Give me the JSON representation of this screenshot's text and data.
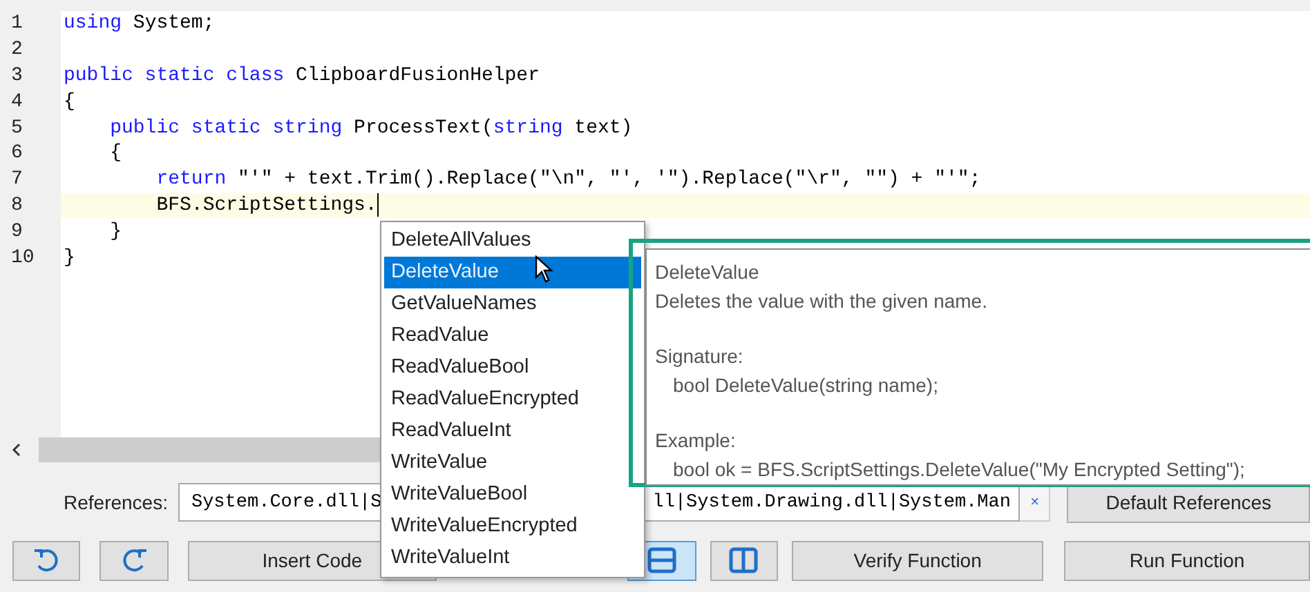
{
  "editor": {
    "lines": [
      {
        "number": "1",
        "current": false,
        "tokens": [
          {
            "kind": "keyword",
            "text": "using"
          },
          {
            "kind": "plain",
            "text": " System;"
          }
        ]
      },
      {
        "number": "2",
        "current": false
      },
      {
        "number": "3",
        "current": false,
        "tokens": [
          {
            "kind": "keyword",
            "text": "public static class"
          },
          {
            "kind": "plain",
            "text": " ClipboardFusionHelper"
          }
        ]
      },
      {
        "number": "4",
        "current": false,
        "tokens": [
          {
            "kind": "plain",
            "text": "{"
          }
        ]
      },
      {
        "number": "5",
        "current": false,
        "tokens": [
          {
            "kind": "keyword",
            "text": "    public static string"
          },
          {
            "kind": "plain",
            "text": " ProcessText("
          },
          {
            "kind": "keyword",
            "text": "string"
          },
          {
            "kind": "plain",
            "text": " text)"
          }
        ]
      },
      {
        "number": "6",
        "current": false,
        "tokens": [
          {
            "kind": "plain",
            "text": "    {"
          }
        ]
      },
      {
        "number": "7",
        "current": false,
        "tokens": [
          {
            "kind": "keyword",
            "text": "        return"
          },
          {
            "kind": "plain",
            "text": " \"'\" + text.Trim().Replace(\"\\n\", \"', '\").Replace(\"\\r\", \"\") + \"'\";"
          }
        ]
      },
      {
        "number": "8",
        "current": true,
        "tokens": [
          {
            "kind": "plain",
            "text": "        BFS.ScriptSettings."
          }
        ]
      },
      {
        "number": "9",
        "current": false,
        "tokens": [
          {
            "kind": "plain",
            "text": "    }"
          }
        ]
      },
      {
        "number": "10",
        "current": false,
        "tokens": [
          {
            "kind": "plain",
            "text": "}"
          }
        ]
      }
    ]
  },
  "completion_list": {
    "items": [
      {
        "label": "DeleteAllValues",
        "selected": false
      },
      {
        "label": "DeleteValue",
        "selected": true
      },
      {
        "label": "GetValueNames",
        "selected": false
      },
      {
        "label": "ReadValue",
        "selected": false
      },
      {
        "label": "ReadValueBool",
        "selected": false
      },
      {
        "label": "ReadValueEncrypted",
        "selected": false
      },
      {
        "label": "ReadValueInt",
        "selected": false
      },
      {
        "label": "WriteValue",
        "selected": false
      },
      {
        "label": "WriteValueBool",
        "selected": false
      },
      {
        "label": "WriteValueEncrypted",
        "selected": false
      },
      {
        "label": "WriteValueInt",
        "selected": false
      }
    ]
  },
  "tooltip": {
    "title": "DeleteValue",
    "description": "Deletes the value with the given name.",
    "signature_label": "Signature:",
    "signature": "bool DeleteValue(string name);",
    "example_label": "Example:",
    "example": "bool ok = BFS.ScriptSettings.DeleteValue(\"My Encrypted Setting\");"
  },
  "references": {
    "label": "References:",
    "value_start": "System.Core.dll|S",
    "value_end": "ll|System.Drawing.dll|System.Man",
    "clear": "×",
    "default_button": "Default References"
  },
  "toolbar": {
    "layout_buttons": [
      {
        "kind": "horizontal",
        "selected": true
      },
      {
        "kind": "vertical",
        "selected": false
      }
    ],
    "insert_button": "Insert Code",
    "verify_button": "Verify Function",
    "run_button": "Run Function"
  }
}
